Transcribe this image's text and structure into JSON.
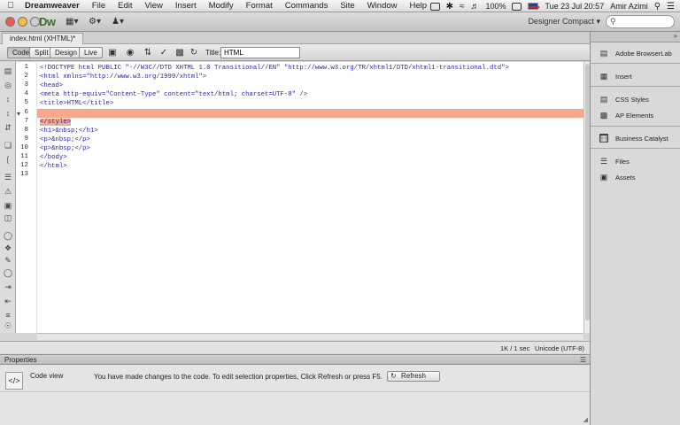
{
  "menubar": {
    "app_name": "Dreamweaver",
    "menus": [
      "File",
      "Edit",
      "View",
      "Insert",
      "Modify",
      "Format",
      "Commands",
      "Site",
      "Window",
      "Help"
    ],
    "battery": "100%",
    "clock": "Tue 23 Jul  20:57",
    "user": "Amir Azimi"
  },
  "appbar": {
    "logo": "Dw",
    "workspace": "Designer Compact"
  },
  "document": {
    "tab_title": "index.html (XHTML)*",
    "view_buttons": [
      "Code",
      "Split",
      "Design",
      "Live"
    ],
    "active_view": "Code",
    "title_label": "Title:",
    "title_value": "HTML"
  },
  "code": {
    "line_numbers": [
      "1",
      "2",
      "3",
      "4",
      "5",
      "6",
      "7",
      "8",
      "9",
      "10",
      "11",
      "12",
      "13"
    ],
    "lines": [
      "<!DOCTYPE html PUBLIC \"-//W3C//DTD XHTML 1.0 Transitional//EN\" \"http://www.w3.org/TR/xhtml1/DTD/xhtml1-transitional.dtd\">",
      "<html xmlns=\"http://www.w3.org/1999/xhtml\">",
      "<head>",
      "<meta http-equiv=\"Content-Type\" content=\"text/html; charset=UTF-8\" />",
      "<title>HTML</title>",
      "",
      "</style>",
      "<h1>&nbsp;</h1>",
      "<p>&nbsp;</p>",
      "<p>&nbsp;</p>",
      "</body>",
      "</html>",
      ""
    ],
    "highlighted_line": 6,
    "highlighted_text_line": 7
  },
  "statusbar": {
    "size": "1K / 1 sec",
    "encoding": "Unicode (UTF-8)"
  },
  "properties": {
    "title": "Properties",
    "code_view_label": "Code view",
    "message": "You have made changes to the code. To edit selection properties, Click Refresh or press F5.",
    "refresh_label": "Refresh"
  },
  "right_panel": {
    "items": [
      {
        "label": "Adobe BrowserLab",
        "icon": "browserlab-icon"
      },
      {
        "label": "Insert",
        "icon": "insert-icon"
      },
      {
        "label": "CSS Styles",
        "icon": "css-styles-icon"
      },
      {
        "label": "AP Elements",
        "icon": "ap-elements-icon"
      },
      {
        "label": "Business Catalyst",
        "icon": "business-catalyst-icon"
      },
      {
        "label": "Files",
        "icon": "files-icon"
      },
      {
        "label": "Assets",
        "icon": "assets-icon"
      }
    ]
  }
}
